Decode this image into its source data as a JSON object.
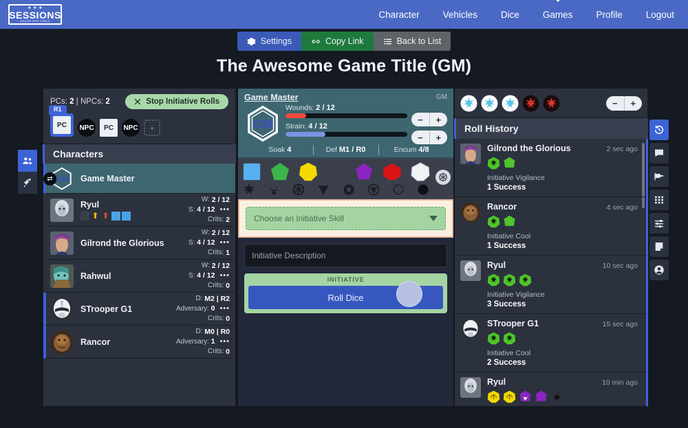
{
  "brand": {
    "top": "★ ★ ★",
    "main": "SESSIONS",
    "bottom": "ONLINE RPG TOOLS"
  },
  "nav": {
    "items": [
      {
        "label": "Character",
        "active": false
      },
      {
        "label": "Vehicles",
        "active": false
      },
      {
        "label": "Dice",
        "active": false
      },
      {
        "label": "Games",
        "active": true
      },
      {
        "label": "Profile",
        "active": false
      },
      {
        "label": "Logout",
        "active": false
      }
    ]
  },
  "toolbar": {
    "settings_label": "Settings",
    "copy_label": "Copy Link",
    "back_label": "Back to List"
  },
  "page_title": "The Awesome Game Title (GM)",
  "initiative": {
    "pcs_text": "PCs:",
    "pcs_value": "2",
    "separator": "|",
    "npcs_text": "NPCs:",
    "npcs_value": "2",
    "stop_label": "Stop Initiative Rolls",
    "stop_icon": "close-icon",
    "round_label": "R1",
    "tokens": [
      {
        "label": "PC",
        "type": "pc",
        "selected": true
      },
      {
        "label": "NPC",
        "type": "npc",
        "selected": false
      },
      {
        "label": "PC",
        "type": "pc",
        "selected": false
      },
      {
        "label": "NPC",
        "type": "npc",
        "selected": false
      }
    ],
    "add_label": "+"
  },
  "left_rail": [
    {
      "icon": "characters-icon",
      "active": true
    },
    {
      "icon": "rocket-icon",
      "active": false
    }
  ],
  "characters": {
    "header": "Characters",
    "rows": [
      {
        "name": "Game Master",
        "kind": "gm",
        "avatar": "gm-hex-badge",
        "swap_icon": "swap-icon"
      },
      {
        "name": "Ryul",
        "kind": "pc",
        "stat1_label": "W:",
        "stat1_value": "2 / 12",
        "stat2_label": "S:",
        "stat2_value": "4 / 12",
        "stat3_label": "Crits:",
        "stat3_value": "2",
        "menu": "•••",
        "chips": [
          "#3a3f4b",
          "#f2c200",
          "#e24a3b",
          "#4aa3e8",
          "#4aa3e8"
        ]
      },
      {
        "name": "Gilrond the Glorious",
        "kind": "pc",
        "stat1_label": "W:",
        "stat1_value": "2 / 12",
        "stat2_label": "S:",
        "stat2_value": "4 / 12",
        "stat3_label": "Crits:",
        "stat3_value": "1",
        "menu": "•••",
        "chips": []
      },
      {
        "name": "Rahwul",
        "kind": "pc",
        "stat1_label": "W:",
        "stat1_value": "2 / 12",
        "stat2_label": "S:",
        "stat2_value": "4 / 12",
        "stat3_label": "Crits:",
        "stat3_value": "0",
        "menu": "•••",
        "chips": []
      },
      {
        "name": "STrooper G1",
        "kind": "npc",
        "stat1_label": "D:",
        "stat1_value": "M2 | R2",
        "stat2_label": "Adversary:",
        "stat2_value": "0",
        "stat3_label": "Crits:",
        "stat3_value": "0",
        "menu": "•••",
        "chips": []
      },
      {
        "name": "Rancor",
        "kind": "npc",
        "stat1_label": "D:",
        "stat1_value": "M0 | R0",
        "stat2_label": "Adversary:",
        "stat2_value": "1",
        "stat3_label": "Crits:",
        "stat3_value": "0",
        "menu": "•••",
        "chips": []
      }
    ]
  },
  "gm_card": {
    "title": "Game Master",
    "tag": "GM",
    "wounds_label": "Wounds:",
    "wounds_value": "2 / 12",
    "wounds_pct": 17,
    "wounds_color": "#f24a3c",
    "strain_label": "Strain:",
    "strain_value": "4 / 12",
    "strain_pct": 33,
    "strain_color": "#7b94e0",
    "minus": "−",
    "plus": "+",
    "soak_label": "Soak",
    "soak_value": "4",
    "def_label": "Def",
    "def_value": "M1 / R0",
    "encum_label": "Encum",
    "encum_value": "4/8"
  },
  "dice_tray": {
    "dice": [
      {
        "name": "boost-die",
        "color": "#57b0ef",
        "shape": "square"
      },
      {
        "name": "ability-die",
        "color": "#3cb54a",
        "shape": "octagon"
      },
      {
        "name": "proficiency-die",
        "color": "#f2d900",
        "shape": "decagon"
      },
      {
        "name": "setback-die",
        "color": "#3a3f4b",
        "shape": "square"
      },
      {
        "name": "difficulty-die",
        "color": "#8c25c4",
        "shape": "octagon"
      },
      {
        "name": "challenge-die",
        "color": "#d81414",
        "shape": "decagon"
      },
      {
        "name": "force-die",
        "color": "#f0f2f6",
        "shape": "decagon"
      }
    ],
    "symbols": [
      "advantage-icon",
      "triumph-icon",
      "force-light-icon",
      "threat-icon",
      "despair-icon",
      "failure-icon",
      "blank-circle-icon",
      "black-circle-icon"
    ],
    "gear_icon": "dice-gear-icon"
  },
  "skill_select": {
    "placeholder": "Choose an Initiative Skill",
    "caret_icon": "chevron-down-icon"
  },
  "description": {
    "placeholder": "Initiative Description"
  },
  "roll": {
    "label": "INITIATIVE",
    "button": "Roll Dice"
  },
  "right_dice_bar": {
    "dice": [
      {
        "name": "white-die",
        "face": "#ffffff",
        "pip": "#59c6e6"
      },
      {
        "name": "white-die",
        "face": "#ffffff",
        "pip": "#59c6e6"
      },
      {
        "name": "white-die",
        "face": "#ffffff",
        "pip": "#59c6e6"
      },
      {
        "name": "red-die",
        "face": "#1a0c0c",
        "pip": "#d8352a"
      },
      {
        "name": "red-die",
        "face": "#1a0c0c",
        "pip": "#d8352a"
      }
    ],
    "minus": "−",
    "plus": "+"
  },
  "roll_history": {
    "header": "Roll History",
    "items": [
      {
        "name": "Gilrond the Glorious",
        "time": "2 sec ago",
        "avatar": "#7a4a86",
        "round": false,
        "dice": [
          "advantage-green",
          "ability-green"
        ],
        "skill": "Initiative Vigilance",
        "result": "1 Success"
      },
      {
        "name": "Rancor",
        "time": "4 sec ago",
        "avatar": "#7a5030",
        "round": true,
        "dice": [
          "advantage-green",
          "ability-green"
        ],
        "skill": "Initiative Cool",
        "result": "1 Success"
      },
      {
        "name": "Ryul",
        "time": "10 sec ago",
        "avatar": "#8f9299",
        "round": false,
        "dice": [
          "advantage-green",
          "advantage-green",
          "advantage-green"
        ],
        "skill": "Initiative Vigilance",
        "result": "3 Success"
      },
      {
        "name": "STrooper G1",
        "time": "15 sec ago",
        "avatar": "#c9ccd4",
        "round": true,
        "dice": [
          "advantage-green",
          "advantage-green"
        ],
        "skill": "Initiative Cool",
        "result": "2 Success"
      },
      {
        "name": "Ryul",
        "time": "10 min ago",
        "avatar": "#8f9299",
        "round": false,
        "dice": [
          "yellow-die",
          "yellow-die",
          "purple-die",
          "purple-die",
          "black-sym"
        ],
        "skill": "",
        "result": ""
      }
    ]
  },
  "right_rail": [
    {
      "icon": "history-icon",
      "active": true
    },
    {
      "icon": "chat-icon",
      "active": false
    },
    {
      "icon": "map-pin-icon",
      "active": false
    },
    {
      "icon": "grid-icon",
      "active": false
    },
    {
      "icon": "sliders-icon",
      "active": false
    },
    {
      "icon": "note-icon",
      "active": false
    },
    {
      "icon": "user-icon",
      "active": false
    }
  ]
}
